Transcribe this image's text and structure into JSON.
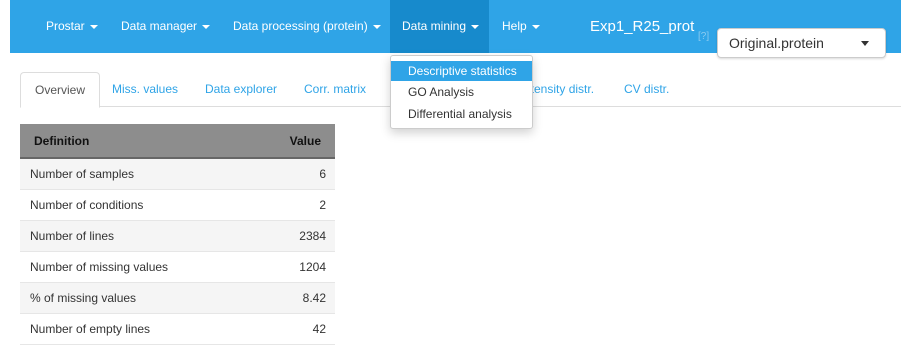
{
  "navbar": {
    "items": [
      {
        "label": "Prostar"
      },
      {
        "label": "Data manager"
      },
      {
        "label": "Data processing (protein)"
      },
      {
        "label": "Data mining"
      },
      {
        "label": "Help"
      }
    ],
    "active_item": "Data mining",
    "dataset_title": "Exp1_R25_prot",
    "help_mark": "[?]",
    "dataset_select": {
      "value": "Original.protein"
    },
    "accent_color": "#2fa4e7",
    "active_color": "#178acc"
  },
  "dropdown": {
    "items": [
      {
        "label": "Descriptive statistics"
      },
      {
        "label": "GO Analysis"
      },
      {
        "label": "Differential analysis"
      }
    ],
    "highlighted": "Descriptive statistics"
  },
  "tabs": {
    "items": [
      {
        "label": "Overview"
      },
      {
        "label": "Miss. values"
      },
      {
        "label": "Data explorer"
      },
      {
        "label": "Corr. matrix"
      },
      {
        "label": "ntensity distr."
      },
      {
        "label": "CV distr."
      }
    ],
    "active": "Overview"
  },
  "table": {
    "headers": {
      "definition": "Definition",
      "value": "Value"
    },
    "rows": [
      {
        "definition": "Number of samples",
        "value": "6"
      },
      {
        "definition": "Number of conditions",
        "value": "2"
      },
      {
        "definition": "Number of lines",
        "value": "2384"
      },
      {
        "definition": "Number of missing values",
        "value": "1204"
      },
      {
        "definition": "% of missing values",
        "value": "8.42"
      },
      {
        "definition": "Number of empty lines",
        "value": "42"
      }
    ]
  }
}
